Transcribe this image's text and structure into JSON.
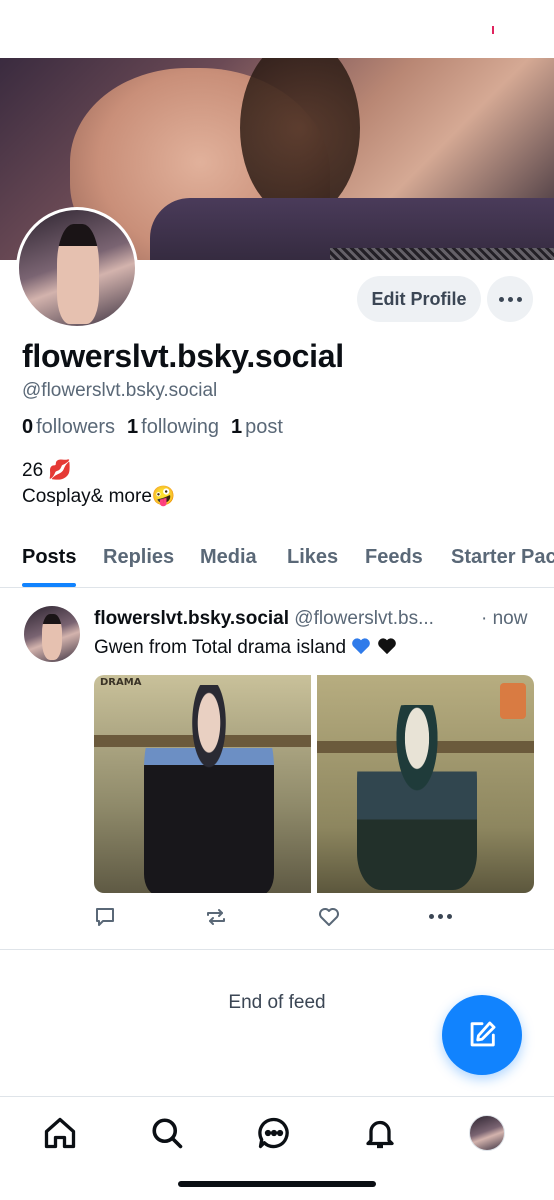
{
  "profile": {
    "display_name": "flowerslvt.bsky.social",
    "handle": "@flowerslvt.bsky.social",
    "followers_count": "0",
    "followers_label": "followers",
    "following_count": "1",
    "following_label": "following",
    "posts_count": "1",
    "posts_label": "post",
    "bio_line1": "26 💋",
    "bio_line2": "Cosplay& more🤪",
    "edit_button": "Edit Profile"
  },
  "tabs": [
    "Posts",
    "Replies",
    "Media",
    "Likes",
    "Feeds",
    "Starter Pac"
  ],
  "active_tab": "Posts",
  "post": {
    "author": "flowerslvt.bsky.social",
    "handle": "@flowerslvt.bs...",
    "time": "· now",
    "text": "Gwen from Total drama island",
    "image_tag": "DRAMA",
    "hearts": [
      "blue-heart",
      "black-heart"
    ]
  },
  "feed_end": "End of feed",
  "nav": [
    "home-icon",
    "search-icon",
    "chat-icon",
    "bell-icon",
    "profile-avatar"
  ],
  "colors": {
    "accent": "#1183fe",
    "muted_text": "#5a6877",
    "button_bg": "#eef1f4",
    "divider": "#dfe4e9"
  }
}
